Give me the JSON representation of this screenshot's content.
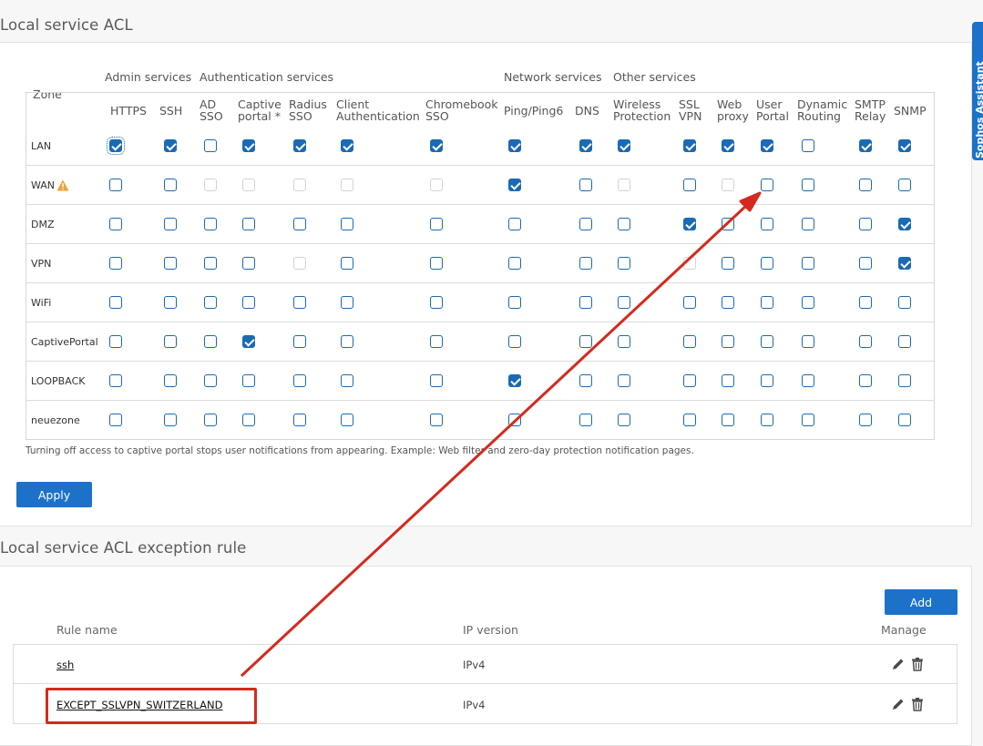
{
  "acl": {
    "title": "Local service ACL",
    "zone_header": "Zone",
    "groups": [
      "Admin services",
      "Authentication services",
      "Network services",
      "Other services"
    ],
    "columns": [
      "HTTPS",
      "SSH",
      "AD\nSSO",
      "Captive\nportal *",
      "Radius\nSSO",
      "Client\nAuthentication",
      "Chromebook\nSSO",
      "Ping/Ping6",
      "DNS",
      "Wireless\nProtection",
      "SSL\nVPN",
      "Web\nproxy",
      "User\nPortal",
      "Dynamic\nRouting",
      "SMTP\nRelay",
      "SNMP"
    ],
    "zones": [
      {
        "name": "LAN",
        "warning": false,
        "states": [
          "checked",
          "checked",
          "unchecked",
          "checked",
          "checked",
          "checked",
          "checked",
          "checked",
          "checked",
          "checked",
          "checked",
          "checked",
          "checked",
          "unchecked",
          "checked",
          "checked"
        ]
      },
      {
        "name": "WAN",
        "warning": true,
        "states": [
          "unchecked",
          "unchecked",
          "disabled",
          "disabled",
          "disabled",
          "disabled",
          "disabled",
          "checked",
          "unchecked",
          "disabled",
          "unchecked",
          "disabled",
          "unchecked",
          "unchecked",
          "unchecked",
          "unchecked"
        ]
      },
      {
        "name": "DMZ",
        "warning": false,
        "states": [
          "unchecked",
          "unchecked",
          "unchecked",
          "unchecked",
          "unchecked",
          "unchecked",
          "unchecked",
          "unchecked",
          "unchecked",
          "unchecked",
          "checked",
          "unchecked",
          "unchecked",
          "unchecked",
          "unchecked",
          "checked"
        ]
      },
      {
        "name": "VPN",
        "warning": false,
        "states": [
          "unchecked",
          "unchecked",
          "unchecked",
          "unchecked",
          "disabled",
          "unchecked",
          "unchecked",
          "unchecked",
          "unchecked",
          "unchecked",
          "disabled",
          "unchecked",
          "unchecked",
          "unchecked",
          "unchecked",
          "checked"
        ]
      },
      {
        "name": "WiFi",
        "warning": false,
        "states": [
          "unchecked",
          "unchecked",
          "unchecked",
          "unchecked",
          "unchecked",
          "unchecked",
          "unchecked",
          "unchecked",
          "unchecked",
          "unchecked",
          "unchecked",
          "unchecked",
          "unchecked",
          "unchecked",
          "unchecked",
          "unchecked"
        ]
      },
      {
        "name": "CaptivePortal",
        "warning": false,
        "states": [
          "unchecked",
          "unchecked",
          "unchecked",
          "checked",
          "unchecked",
          "unchecked",
          "unchecked",
          "unchecked",
          "unchecked",
          "unchecked",
          "unchecked",
          "unchecked",
          "unchecked",
          "unchecked",
          "unchecked",
          "unchecked"
        ]
      },
      {
        "name": "LOOPBACK",
        "warning": false,
        "states": [
          "unchecked",
          "unchecked",
          "unchecked",
          "unchecked",
          "unchecked",
          "unchecked",
          "unchecked",
          "checked",
          "unchecked",
          "unchecked",
          "unchecked",
          "unchecked",
          "unchecked",
          "unchecked",
          "unchecked",
          "unchecked"
        ]
      },
      {
        "name": "neuezone",
        "warning": false,
        "states": [
          "unchecked",
          "unchecked",
          "unchecked",
          "unchecked",
          "unchecked",
          "unchecked",
          "unchecked",
          "unchecked",
          "unchecked",
          "unchecked",
          "unchecked",
          "unchecked",
          "unchecked",
          "unchecked",
          "unchecked",
          "unchecked"
        ]
      }
    ],
    "note": "Turning off access to captive portal stops user notifications from appearing. Example: Web filter and zero-day protection notification pages.",
    "apply_label": "Apply"
  },
  "exceptions": {
    "title": "Local service ACL exception rule",
    "add_label": "Add",
    "headers": {
      "rule_name": "Rule name",
      "ip_version": "IP version",
      "manage": "Manage"
    },
    "rules": [
      {
        "name": "ssh",
        "ip": "IPv4"
      },
      {
        "name": "EXCEPT_SSLVPN_SWITZERLAND",
        "ip": "IPv4"
      }
    ]
  },
  "assistant": {
    "label": "Sophos Assistant"
  },
  "colors": {
    "accent": "#1c72c9",
    "annotation": "#d42a1e",
    "warning": "#f0a033"
  },
  "icons": [
    "warning-icon",
    "edit-icon",
    "delete-icon"
  ]
}
